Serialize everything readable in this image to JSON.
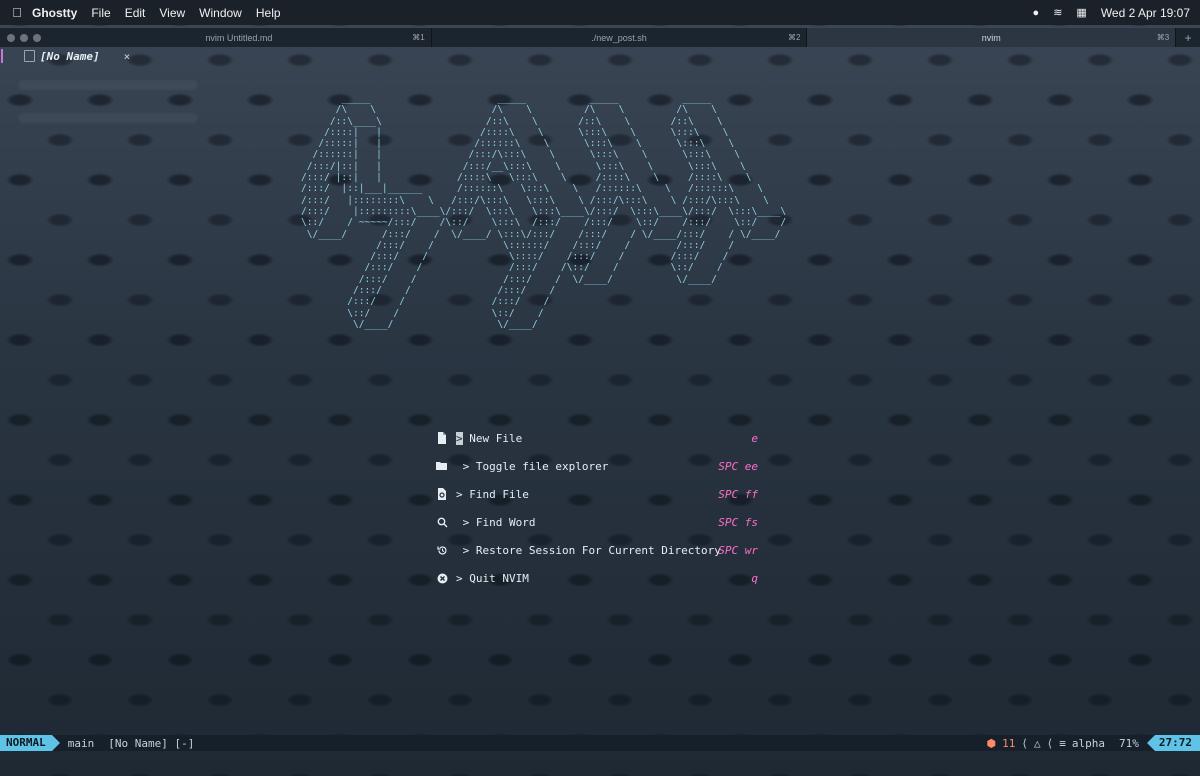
{
  "menubar": {
    "apple": "",
    "app": "Ghostty",
    "items": [
      "File",
      "Edit",
      "View",
      "Window",
      "Help"
    ],
    "clock": "Wed 2 Apr  19:07"
  },
  "tabs": [
    {
      "label": "nvim Untitled.md",
      "kbd": "⌘1"
    },
    {
      "label": "./new_post.sh",
      "kbd": "⌘2"
    },
    {
      "label": "nvim",
      "kbd": "⌘3"
    }
  ],
  "tab_add": "+",
  "buffer": {
    "name": "[No Name]",
    "close": "×"
  },
  "ascii_art": "       _____                      _____           _____           _____\n      /\\    \\                    /\\    \\         /\\    \\         /\\    \\\n     /::\\____\\                  /::\\    \\       /::\\    \\       /::\\    \\\n    /::::|   |                 /::::\\    \\      \\:::\\    \\      \\:::\\    \\\n   /:::::|   |                /::::::\\    \\      \\:::\\    \\      \\:::\\    \\\n  /::::::|   |               /:::/\\:::\\    \\      \\:::\\    \\      \\:::\\    \\\n /:::/|::|   |              /:::/__\\:::\\    \\      \\:::\\    \\      \\:::\\    \\\n/:::/ |::|   |             /::::\\   \\:::\\    \\     /::::\\    \\     /::::\\    \\\n/:::/  |::|___|______      /::::::\\   \\:::\\    \\   /::::::\\    \\   /::::::\\    \\\n/:::/   |::::::::\\    \\   /:::/\\:::\\   \\:::\\    \\ /:::/\\:::\\    \\ /:::/\\:::\\    \\\n/:::/    |:::::::::\\____\\/:::/  \\:::\\   \\:::\\____\\/:::/  \\:::\\____\\/:::/  \\:::\\____\\\n\\::/    / ~~~~~/:::/    /\\::/    \\:::\\  /:::/    /:::/    \\::/    /:::/    \\::/    /\n \\/____/      /:::/    /  \\/____/ \\:::\\/:::/    /:::/    / \\/____/:::/    / \\/____/\n             /:::/    /            \\::::::/    /:::/    /        /:::/    /\n            /:::/    /              \\::::/    /:::/    /        /:::/    /\n           /:::/    /               /:::/    /\\::/    /         \\::/    /\n          /:::/    /               /:::/    /  \\/____/           \\/____/\n         /:::/    /               /:::/    /\n        /:::/    /               /:::/    /\n        \\::/    /                \\::/    /\n         \\/____/                  \\/____/",
  "dashboard": [
    {
      "icon": "new-file-icon",
      "label": "> New File",
      "key": "e"
    },
    {
      "icon": "folder-icon",
      "label": " > Toggle file explorer",
      "key": "SPC ee"
    },
    {
      "icon": "find-file-icon",
      "label": "> Find File",
      "key": "SPC ff"
    },
    {
      "icon": "search-icon",
      "label": " > Find Word",
      "key": "SPC fs"
    },
    {
      "icon": "restore-icon",
      "label": " > Restore Session For Current Directory",
      "key": "SPC wr"
    },
    {
      "icon": "quit-icon",
      "label": "> Quit NVIM",
      "key": "q"
    }
  ],
  "status": {
    "mode": "NORMAL",
    "branch": " main",
    "file": "[No Name] [-]",
    "diagnostics": "11",
    "filetype": "alpha",
    "percent": "71%",
    "position": "27:72"
  },
  "colors": {
    "accent": "#5ec3e6",
    "keyhint": "#ff6ec7",
    "ascii": "#8fcfe3"
  }
}
